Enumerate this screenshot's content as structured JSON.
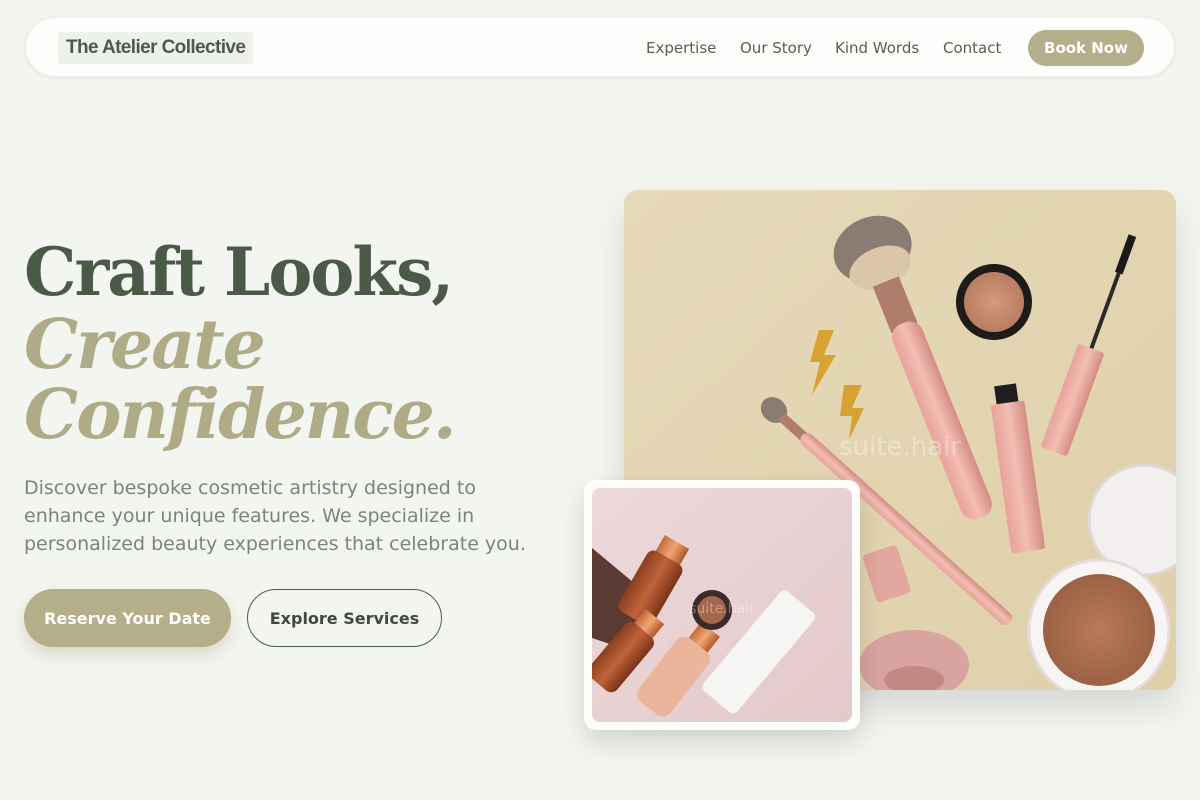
{
  "header": {
    "brand": "The Atelier Collective",
    "nav": [
      "Expertise",
      "Our Story",
      "Kind Words",
      "Contact"
    ],
    "cta": "Book Now"
  },
  "hero": {
    "title_line1": "Craft Looks,",
    "title_line2": "Create",
    "title_line3": "Confidence.",
    "description": "Discover bespoke cosmetic artistry designed to enhance your unique features. We specialize in personalized beauty experiences that celebrate you.",
    "primary_button": "Reserve Your Date",
    "secondary_button": "Explore Services"
  },
  "images": {
    "main_watermark": "suite.hair",
    "small_watermark": "suite.hair"
  },
  "colors": {
    "page_bg": "#f3f5f1",
    "accent": "#b4ae8a",
    "heading_green": "#4a5a47",
    "main_image_bg": "#e6d9b8",
    "small_image_bg": "#e8d3d4"
  }
}
